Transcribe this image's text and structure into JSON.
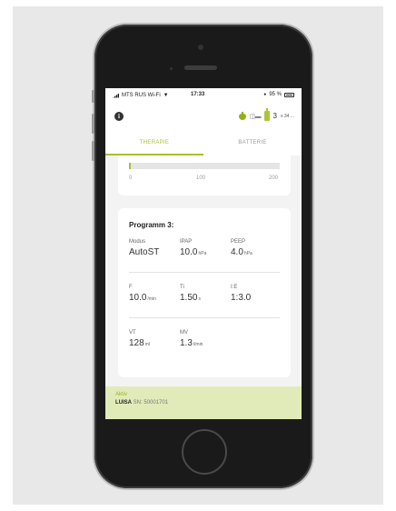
{
  "status_bar": {
    "carrier": "MTS RUS Wi-Fi",
    "time": "17:33",
    "battery_percent": "95 %"
  },
  "header": {
    "info_glyph": "i",
    "right_text": "3",
    "right_small": "x 34 ..."
  },
  "tabs": [
    {
      "label": "THERAPIE",
      "active": true
    },
    {
      "label": "BATTERIE",
      "active": false
    }
  ],
  "gauge": {
    "ticks": [
      "0",
      "100",
      "200"
    ],
    "value": 2,
    "max": 200
  },
  "program": {
    "title": "Programm 3:",
    "rows": [
      [
        {
          "label": "Modus",
          "value": "AutoST",
          "unit": ""
        },
        {
          "label": "IPAP",
          "value": "10.0",
          "unit": "hPa"
        },
        {
          "label": "PEEP",
          "value": "4.0",
          "unit": "hPa"
        }
      ],
      [
        {
          "label": "F",
          "value": "10.0",
          "unit": "/min"
        },
        {
          "label": "Ti",
          "value": "1.50",
          "unit": "s"
        },
        {
          "label": "I:E",
          "value": "1:3.0",
          "unit": ""
        }
      ],
      [
        {
          "label": "VT",
          "value": "128",
          "unit": "ml"
        },
        {
          "label": "MV",
          "value": "1.3",
          "unit": "l/min"
        }
      ]
    ]
  },
  "footer": {
    "status": "Aktiv",
    "device_name": "LUISA",
    "serial": "SN: 50001701"
  },
  "colors": {
    "accent": "#a7c12f",
    "footer_bg": "#e1ebb9"
  }
}
